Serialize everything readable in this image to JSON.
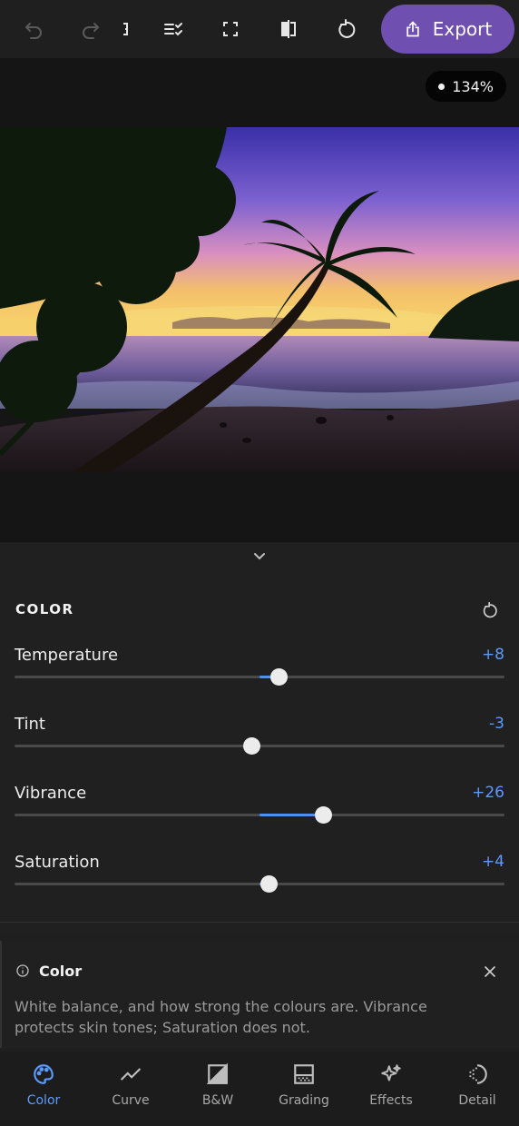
{
  "toolbar": {
    "undo_icon": "undo-icon",
    "redo_icon": "redo-icon",
    "export_label": "Export",
    "export_icon": "share-icon"
  },
  "canvas": {
    "zoom": "134%"
  },
  "color_section": {
    "title": "COLOR",
    "sliders": [
      {
        "label": "Temperature",
        "value_text": "+8",
        "value": 8,
        "fraction": 0.54
      },
      {
        "label": "Tint",
        "value_text": "-3",
        "value": -3,
        "fraction": 0.485
      },
      {
        "label": "Vibrance",
        "value_text": "+26",
        "value": 26,
        "fraction": 0.63
      },
      {
        "label": "Saturation",
        "value_text": "+4",
        "value": 4,
        "fraction": 0.52
      }
    ]
  },
  "info": {
    "title": "Color",
    "text": "White balance, and how strong the colours are. Vibrance protects skin tones; Saturation does not."
  },
  "nav": {
    "items": [
      {
        "label": "Color",
        "icon": "palette-icon",
        "active": true
      },
      {
        "label": "Curve",
        "icon": "curve-icon"
      },
      {
        "label": "B&W",
        "icon": "bw-icon"
      },
      {
        "label": "Grading",
        "icon": "grading-icon"
      },
      {
        "label": "Effects",
        "icon": "sparkle-icon"
      },
      {
        "label": "Detail",
        "icon": "detail-icon"
      }
    ]
  },
  "colors": {
    "accent": "#5b9bff",
    "export": "#6f4fb0",
    "background": "#1f1f1f"
  }
}
